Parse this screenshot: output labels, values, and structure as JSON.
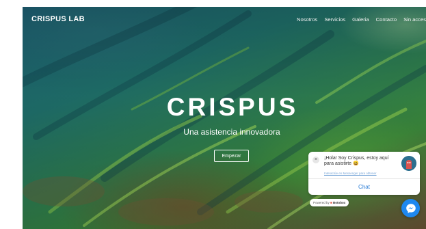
{
  "header": {
    "brand": "CRISPUS LAB",
    "nav": [
      "Nosotros",
      "Servicios",
      "Galeria",
      "Contacto",
      "Sin acces"
    ]
  },
  "hero": {
    "title": "CRISPUS",
    "subtitle": "Una asistencia innovadora",
    "cta_label": "Empezar"
  },
  "chat_widget": {
    "message": "¡Hola! Soy Crispus, estoy aquí para asistirte 😀",
    "link_text": "Interactúe en Messenger para obtener",
    "button_label": "Chat",
    "powered_prefix": "Powered by",
    "powered_brand": "Botobox",
    "close_symbol": "×"
  },
  "icons": {
    "close": "close-icon",
    "avatar": "bot-avatar",
    "messenger": "messenger-icon"
  },
  "colors": {
    "chat_accent": "#2f7fd6",
    "messenger_blue": "#1e88f0"
  }
}
